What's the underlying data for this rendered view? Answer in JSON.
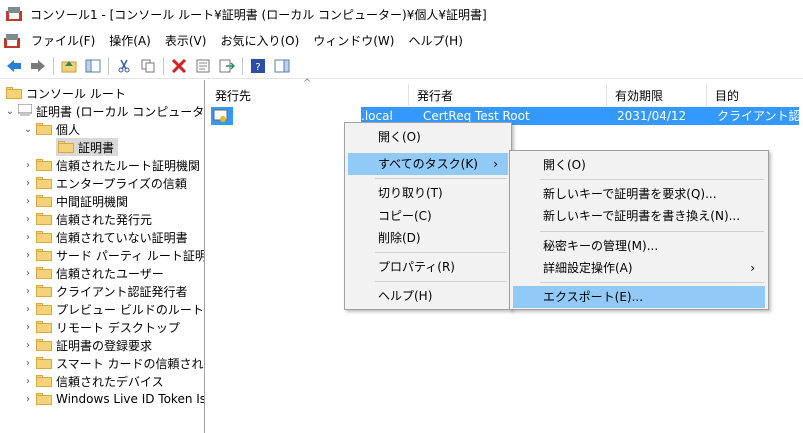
{
  "window": {
    "title": "コンソール1 - [コンソール ルート¥証明書 (ローカル コンピューター)¥個人¥証明書]"
  },
  "menubar": {
    "items": [
      "ファイル(F)",
      "操作(A)",
      "表示(V)",
      "お気に入り(O)",
      "ウィンドウ(W)",
      "ヘルプ(H)"
    ]
  },
  "toolbar": {
    "icons": [
      "back-arrow-icon",
      "forward-arrow-icon",
      "up-folder-icon",
      "show-hide-tree-icon",
      "cut-icon",
      "copy-icon",
      "delete-icon",
      "properties-icon",
      "export-list-icon",
      "help-icon",
      "action-pane-icon"
    ]
  },
  "tree": {
    "items": [
      {
        "label": "コンソール ルート"
      },
      {
        "label": "証明書 (ローカル コンピューター)"
      },
      {
        "label": "個人"
      },
      {
        "label": "証明書"
      },
      {
        "label": "信頼されたルート証明機関"
      },
      {
        "label": "エンタープライズの信頼"
      },
      {
        "label": "中間証明機関"
      },
      {
        "label": "信頼された発行元"
      },
      {
        "label": "信頼されていない証明書"
      },
      {
        "label": "サード パーティ ルート証明機関"
      },
      {
        "label": "信頼されたユーザー"
      },
      {
        "label": "クライアント認証発行者"
      },
      {
        "label": "プレビュー ビルドのルート"
      },
      {
        "label": "リモート デスクトップ"
      },
      {
        "label": "証明書の登録要求"
      },
      {
        "label": "スマート カードの信頼されたルート"
      },
      {
        "label": "信頼されたデバイス"
      },
      {
        "label": "Windows Live ID Token Issuer"
      }
    ]
  },
  "list": {
    "columns": [
      "発行先",
      "発行者",
      "有効期限",
      "目的"
    ],
    "rows": [
      {
        "issued_to": ".local",
        "issued_by": "CertReq Test Root",
        "expires": "2031/04/12",
        "purpose": "クライアント認証"
      }
    ]
  },
  "context_menu": {
    "items": [
      "開く(O)",
      "すべてのタスク(K)",
      "切り取り(T)",
      "コピー(C)",
      "削除(D)",
      "プロパティ(R)",
      "ヘルプ(H)"
    ]
  },
  "submenu": {
    "items": [
      "開く(O)",
      "新しいキーで証明書を要求(Q)...",
      "新しいキーで証明書を書き換え(N)...",
      "秘密キーの管理(M)...",
      "詳細設定操作(A)",
      "エクスポート(E)..."
    ]
  },
  "colors": {
    "selection": "#3399ff",
    "menu_highlight": "#91c9f7",
    "folder": "#f5d27a"
  }
}
